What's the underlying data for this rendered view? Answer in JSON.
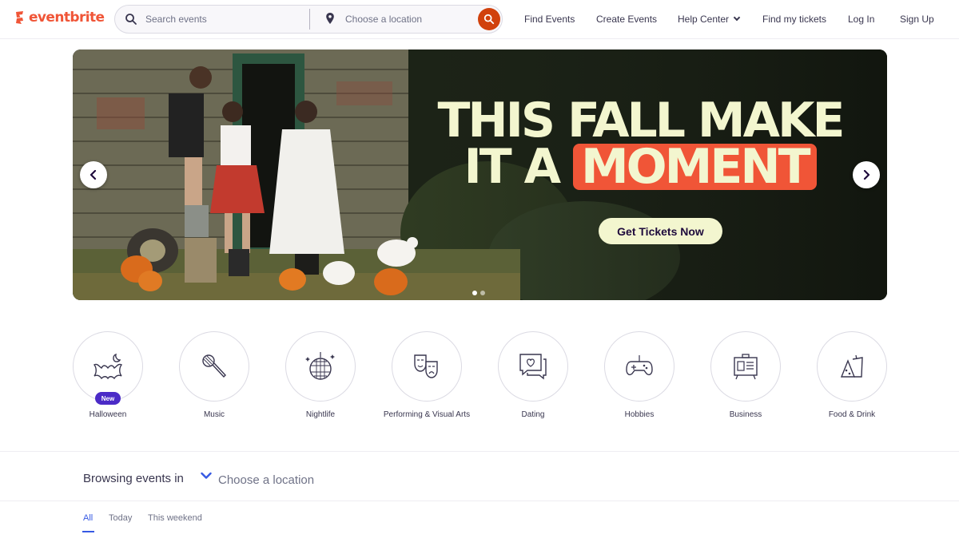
{
  "header": {
    "logo_text": "eventbrite",
    "search_placeholder": "Search events",
    "location_placeholder": "Choose a location",
    "nav": {
      "find_events": "Find Events",
      "create_events": "Create Events",
      "help_center": "Help Center",
      "find_tickets": "Find my tickets",
      "log_in": "Log In",
      "sign_up": "Sign Up"
    }
  },
  "hero": {
    "line1": "THIS FALL MAKE",
    "line2_prefix": "IT A",
    "line2_highlight": "MOMENT",
    "cta": "Get Tickets Now",
    "slide_count": 2,
    "active_slide": 1,
    "colors": {
      "headline": "#f3f6cf",
      "highlight": "#f05537"
    }
  },
  "categories": [
    {
      "label": "Halloween",
      "icon": "halloween-bat-icon",
      "badge": "New"
    },
    {
      "label": "Music",
      "icon": "microphone-icon"
    },
    {
      "label": "Nightlife",
      "icon": "disco-ball-icon"
    },
    {
      "label": "Performing & Visual Arts",
      "icon": "theater-masks-icon"
    },
    {
      "label": "Dating",
      "icon": "chat-heart-icon"
    },
    {
      "label": "Hobbies",
      "icon": "game-controller-icon"
    },
    {
      "label": "Business",
      "icon": "presentation-board-icon"
    },
    {
      "label": "Food & Drink",
      "icon": "food-drink-icon"
    }
  ],
  "browsing": {
    "title": "Browsing events in",
    "location": "Choose a location"
  },
  "tabs": [
    "All",
    "Today",
    "This weekend"
  ],
  "colors": {
    "brand": "#f05537",
    "search_button": "#d1410c",
    "accent": "#3659e3",
    "text": "#39364f"
  }
}
